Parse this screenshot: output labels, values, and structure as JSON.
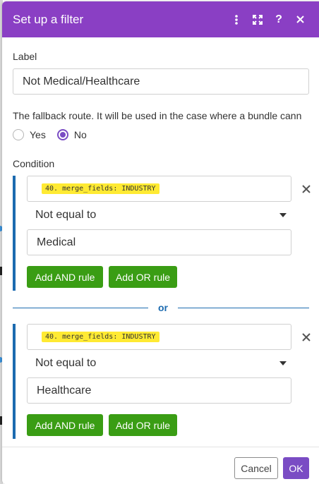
{
  "dialog": {
    "title": "Set up a filter"
  },
  "header_icons": [
    "more-vertical-icon",
    "expand-icon",
    "help-icon",
    "close-icon"
  ],
  "label_section": {
    "label": "Label",
    "value": "Not Medical/Healthcare"
  },
  "fallback": {
    "text": "The fallback route. It will be used in the case where a bundle cann",
    "options": [
      {
        "label": "Yes",
        "selected": false
      },
      {
        "label": "No",
        "selected": true
      }
    ]
  },
  "condition": {
    "label": "Condition",
    "groups": [
      {
        "field": "40. merge_fields: INDUSTRY",
        "operator": "Not equal to",
        "value": "Medical",
        "add_and": "Add AND rule",
        "add_or": "Add OR rule"
      },
      {
        "field": "40. merge_fields: INDUSTRY",
        "operator": "Not equal to",
        "value": "Healthcare",
        "add_and": "Add AND rule",
        "add_or": "Add OR rule"
      }
    ],
    "separator": "or"
  },
  "footer": {
    "cancel": "Cancel",
    "ok": "OK"
  },
  "colors": {
    "header": "#8a3fc4",
    "accent": "#7a4cc4",
    "group_border": "#1c6bb0",
    "green": "#3a9d14",
    "field_pill": "#ffea33"
  }
}
